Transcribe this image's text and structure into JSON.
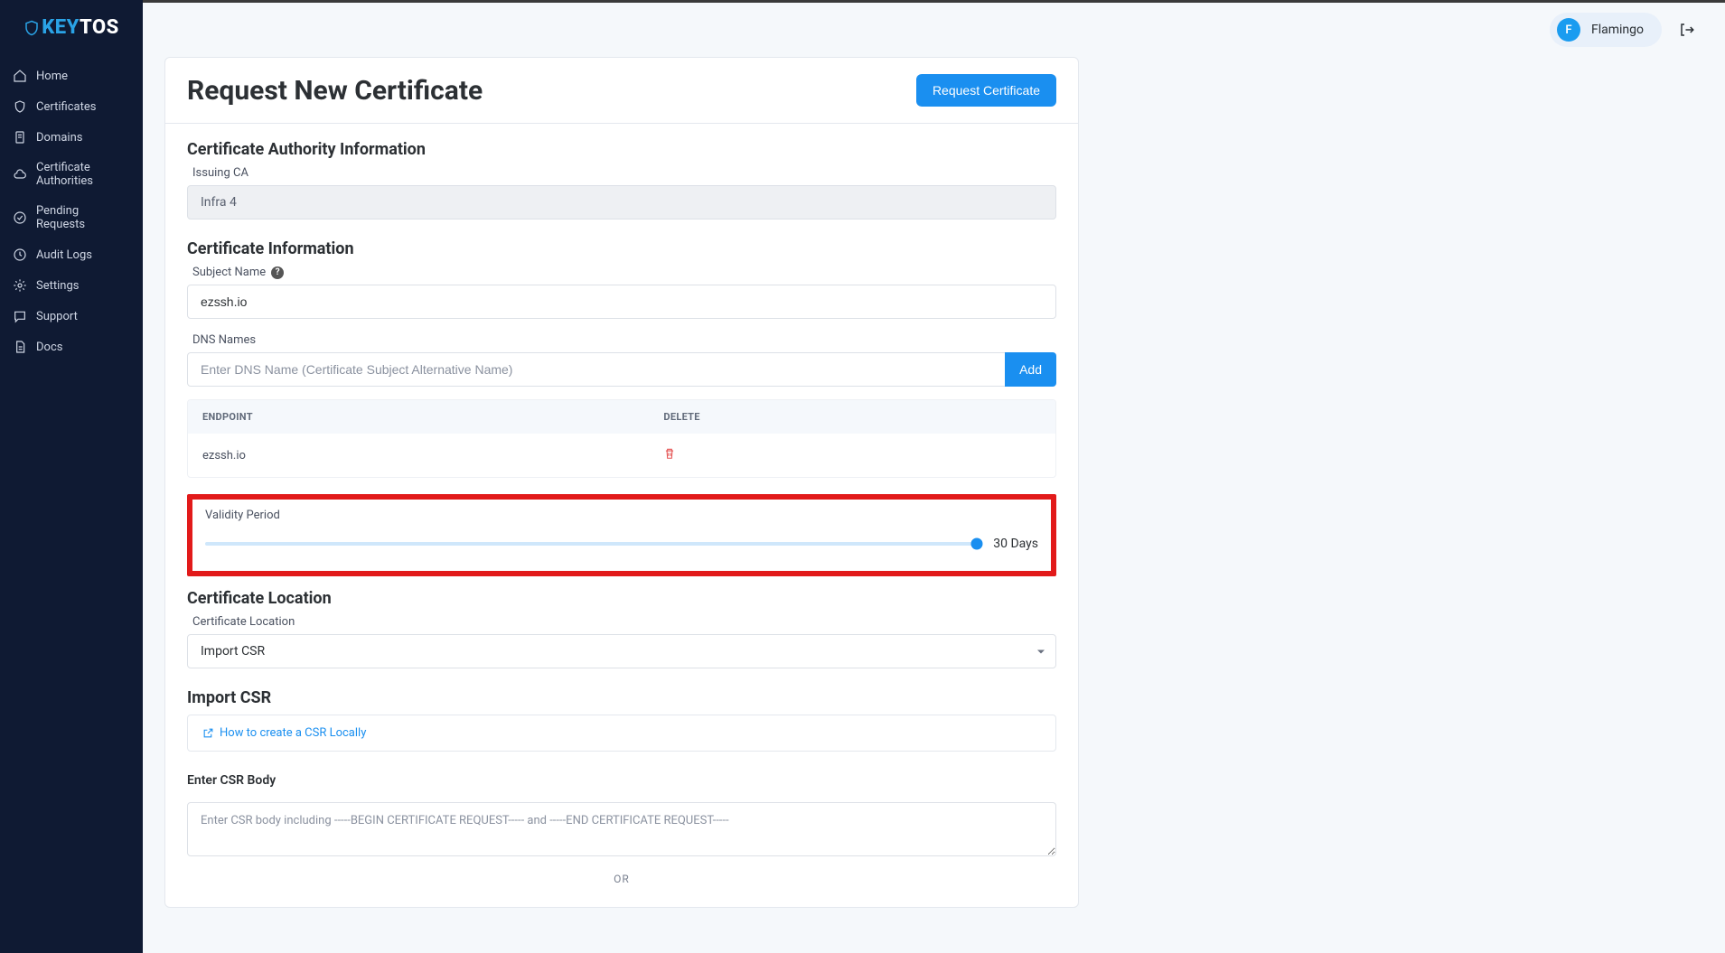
{
  "brand": {
    "part1": "KEY",
    "part2": "TOS"
  },
  "nav": {
    "home": "Home",
    "certificates": "Certificates",
    "domains": "Domains",
    "cas": "Certificate Authorities",
    "pending": "Pending Requests",
    "audit": "Audit Logs",
    "settings": "Settings",
    "support": "Support",
    "docs": "Docs"
  },
  "user": {
    "initial": "F",
    "name": "Flamingo"
  },
  "page": {
    "title": "Request New Certificate",
    "submit_label": "Request Certificate"
  },
  "ca_section": {
    "heading": "Certificate Authority Information",
    "issuing_label": "Issuing CA",
    "issuing_value": "Infra 4"
  },
  "cert_section": {
    "heading": "Certificate Information",
    "subject_label": "Subject Name",
    "subject_value": "ezssh.io",
    "dns_label": "DNS Names",
    "dns_placeholder": "Enter DNS Name (Certificate Subject Alternative Name)",
    "add_label": "Add",
    "table": {
      "head_endpoint": "ENDPOINT",
      "head_delete": "DELETE",
      "rows": [
        {
          "endpoint": "ezssh.io"
        }
      ]
    },
    "validity_label": "Validity Period",
    "validity_value": "30 Days"
  },
  "location_section": {
    "heading": "Certificate Location",
    "label": "Certificate Location",
    "selected": "Import CSR"
  },
  "csr_section": {
    "heading": "Import CSR",
    "help_link": "How to create a CSR Locally",
    "body_label": "Enter CSR Body",
    "body_placeholder": "Enter CSR body including -----BEGIN CERTIFICATE REQUEST----- and -----END CERTIFICATE REQUEST-----",
    "or": "OR"
  }
}
